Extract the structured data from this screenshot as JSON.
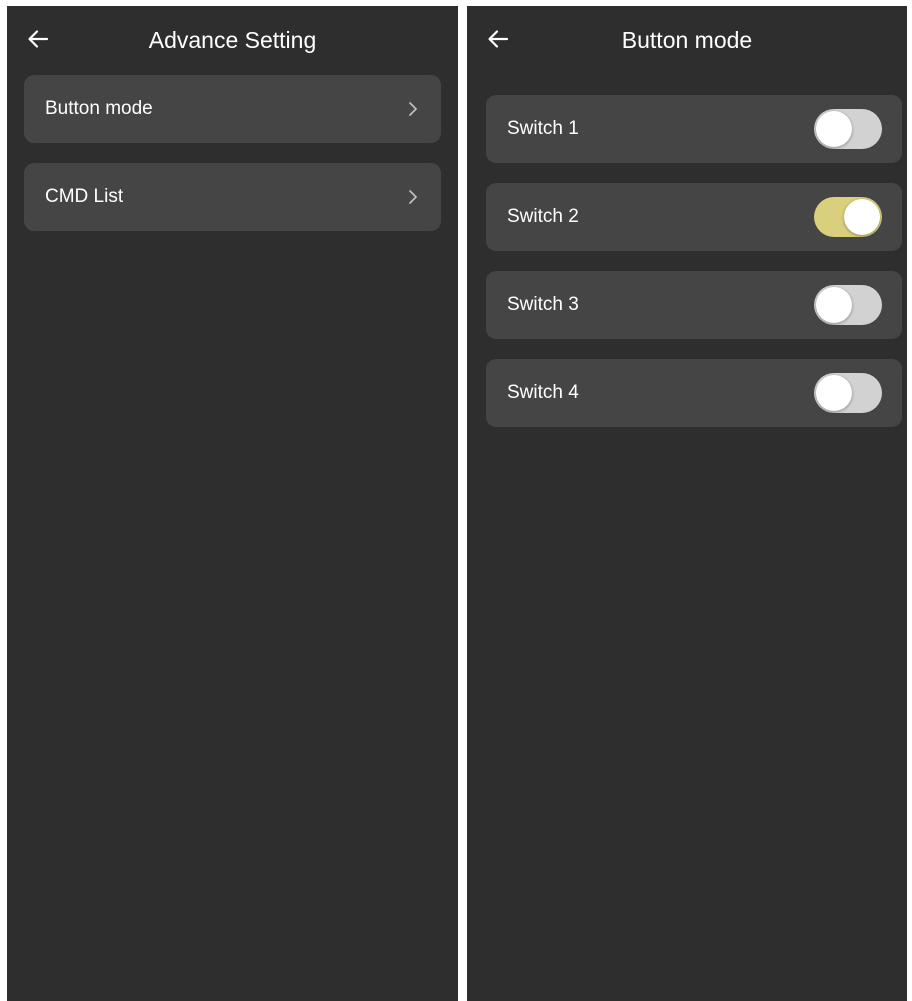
{
  "colors": {
    "background": "#2e2e2e",
    "card": "#454545",
    "text": "#ffffff",
    "toggle_off": "#d2d2d2",
    "toggle_on": "#d9cf7c"
  },
  "left_screen": {
    "title": "Advance Setting",
    "back_icon": "arrow-left-icon",
    "items": [
      {
        "label": "Button mode",
        "icon": "chevron-right-icon"
      },
      {
        "label": "CMD List",
        "icon": "chevron-right-icon"
      }
    ]
  },
  "right_screen": {
    "title": "Button mode",
    "back_icon": "arrow-left-icon",
    "switches": [
      {
        "label": "Switch 1",
        "on": false
      },
      {
        "label": "Switch 2",
        "on": true
      },
      {
        "label": "Switch 3",
        "on": false
      },
      {
        "label": "Switch 4",
        "on": false
      }
    ]
  }
}
